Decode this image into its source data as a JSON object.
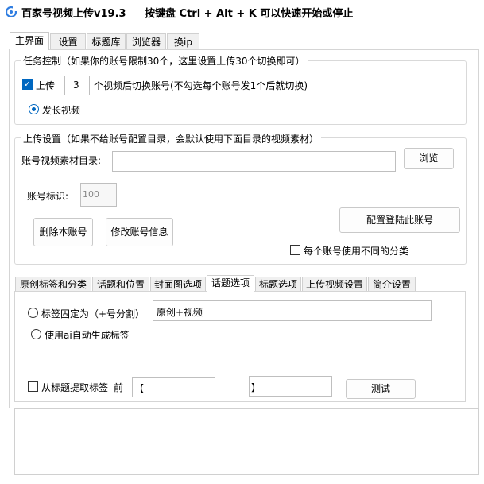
{
  "titlebar": {
    "app_title": "百家号视频上传v19.3",
    "hotkey_hint": "按键盘 Ctrl + Alt + K  可以快速开始或停止"
  },
  "main_tabs": [
    {
      "label": "主界面",
      "active": true
    },
    {
      "label": "设置",
      "active": false
    },
    {
      "label": "标题库",
      "active": false
    },
    {
      "label": "浏览器",
      "active": false
    },
    {
      "label": "换ip",
      "active": false
    }
  ],
  "task_control": {
    "legend": "任务控制（如果你的账号限制30个，这里设置上传30个切换即可）",
    "upload_checkbox_label": "上传",
    "upload_checked": true,
    "upload_count": "3",
    "switch_hint": "个视频后切换账号(不勾选每个账号发1个后就切换)",
    "long_video_label": "发长视频",
    "long_video_selected": true
  },
  "upload_settings": {
    "legend": "上传设置（如果不给账号配置目录，会默认使用下面目录的视频素材）",
    "dir_label": "账号视频素材目录:",
    "dir_value": "",
    "browse_label": "浏览",
    "account_id_label": "账号标识:",
    "account_id_value": "100",
    "delete_account_label": "删除本账号",
    "edit_account_label": "修改账号信息",
    "config_login_label": "配置登陆此账号",
    "diff_category_label": "每个账号使用不同的分类",
    "diff_category_checked": false
  },
  "sub_tabs": [
    {
      "label": "原创标签和分类",
      "active": false
    },
    {
      "label": "话题和位置",
      "active": false
    },
    {
      "label": "封面图选项",
      "active": false
    },
    {
      "label": "话题选项",
      "active": true
    },
    {
      "label": "标题选项",
      "active": false
    },
    {
      "label": "上传视频设置",
      "active": false
    },
    {
      "label": "简介设置",
      "active": false
    }
  ],
  "topic_options": {
    "fixed_tags_label": "标签固定为（+号分割）",
    "fixed_tags_selected": false,
    "fixed_tags_value": "原创+视频",
    "ai_tags_label": "使用ai自动生成标签",
    "ai_tags_selected": false,
    "extract_label": "从标题提取标签",
    "extract_checked": false,
    "before_label": "前",
    "start_delim": "【",
    "end_delim": "】",
    "test_label": "测试"
  },
  "log": {
    "text": ""
  },
  "colors": {
    "accent": "#0067c0",
    "tab_bg": "#f0f0f0",
    "border": "#d5d5d5"
  }
}
